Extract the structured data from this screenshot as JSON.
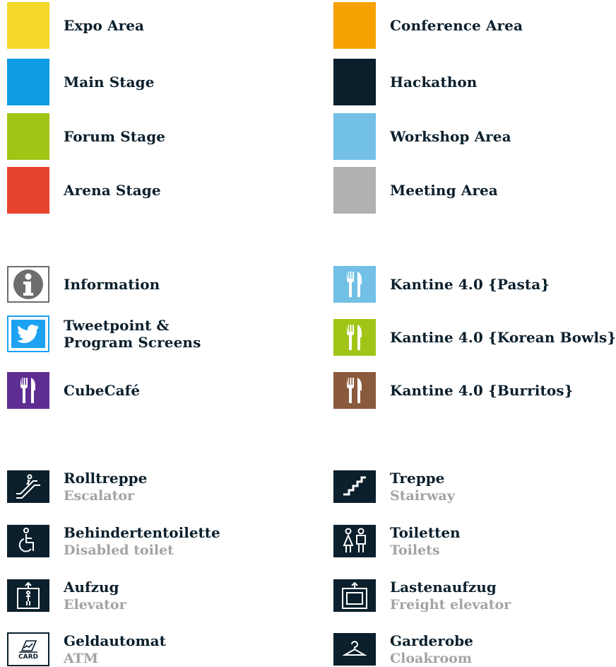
{
  "areas": {
    "left": [
      {
        "label": "Expo Area",
        "color": "#f4d728"
      },
      {
        "label": "Main Stage",
        "color": "#0d9be2"
      },
      {
        "label": "Forum Stage",
        "color": "#a0c517"
      },
      {
        "label": "Arena Stage",
        "color": "#e8432e"
      }
    ],
    "right": [
      {
        "label": "Conference Area",
        "color": "#f5a100"
      },
      {
        "label": "Hackathon",
        "color": "#0b1f2c"
      },
      {
        "label": "Workshop Area",
        "color": "#72c0e6"
      },
      {
        "label": "Meeting Area",
        "color": "#b1b1b1"
      }
    ]
  },
  "points": {
    "left": [
      {
        "label": "Information",
        "icon": "info-icon",
        "color": "#6d6d6d"
      },
      {
        "label": "Tweetpoint & Program Screens",
        "label_line1": "Tweetpoint &",
        "label_line2": "Program Screens",
        "icon": "twitter-bird-icon",
        "color": "#1da1f2"
      },
      {
        "label": "CubeCafé",
        "icon": "fork-knife-icon",
        "color": "#5e2d91"
      }
    ],
    "right": [
      {
        "label": "Kantine 4.0 {Pasta}",
        "icon": "fork-knife-icon",
        "color": "#72c0e6"
      },
      {
        "label": "Kantine 4.0 {Korean Bowls}",
        "icon": "fork-knife-icon",
        "color": "#a0c517"
      },
      {
        "label": "Kantine 4.0 {Burritos}",
        "icon": "fork-knife-icon",
        "color": "#8a5a3c"
      }
    ]
  },
  "facilities": {
    "left": [
      {
        "de": "Rolltreppe",
        "en": "Escalator",
        "icon": "escalator-icon"
      },
      {
        "de": "Behindertentoilette",
        "en": "Disabled toilet",
        "icon": "wheelchair-icon"
      },
      {
        "de": "Aufzug",
        "en": "Elevator",
        "icon": "elevator-icon"
      },
      {
        "de": "Geldautomat",
        "en": "ATM",
        "icon": "atm-card-icon",
        "icon_text": "CARD"
      }
    ],
    "right": [
      {
        "de": "Treppe",
        "en": "Stairway",
        "icon": "stairs-icon"
      },
      {
        "de": "Toiletten",
        "en": "Toilets",
        "icon": "toilets-icon"
      },
      {
        "de": "Lastenaufzug",
        "en": "Freight elevator",
        "icon": "freight-elevator-icon"
      },
      {
        "de": "Garderobe",
        "en": "Cloakroom",
        "icon": "hanger-icon"
      }
    ]
  },
  "colors": {
    "text": "#0b1f2c",
    "subtext": "#a3a3a3",
    "icon_bg": "#0b1f2c"
  }
}
